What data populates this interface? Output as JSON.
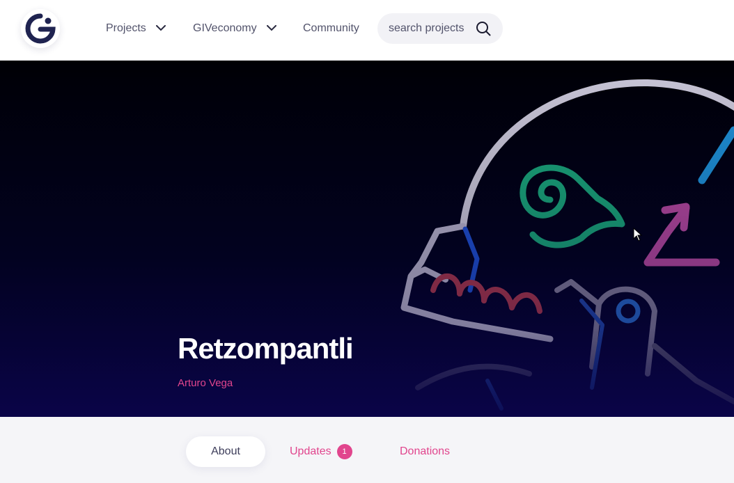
{
  "header": {
    "nav": [
      {
        "label": "Projects"
      },
      {
        "label": "GIVeconomy"
      },
      {
        "label": "Community"
      }
    ],
    "search": {
      "placeholder": "search projects",
      "value": ""
    },
    "icons": {
      "logo": "giveth-logo-icon",
      "search": "search-icon",
      "dropdown": "chevron-down-icon"
    }
  },
  "hero": {
    "title": "Retzompantli",
    "author": "Arturo Vega"
  },
  "tabs": [
    {
      "label": "About",
      "active": true
    },
    {
      "label": "Updates",
      "badge": "1"
    },
    {
      "label": "Donations"
    }
  ],
  "colors": {
    "accent_pink": "#e1458d",
    "nav_text": "#52536b",
    "hero_dark": "#020220",
    "logo_navy": "#1f2350"
  }
}
